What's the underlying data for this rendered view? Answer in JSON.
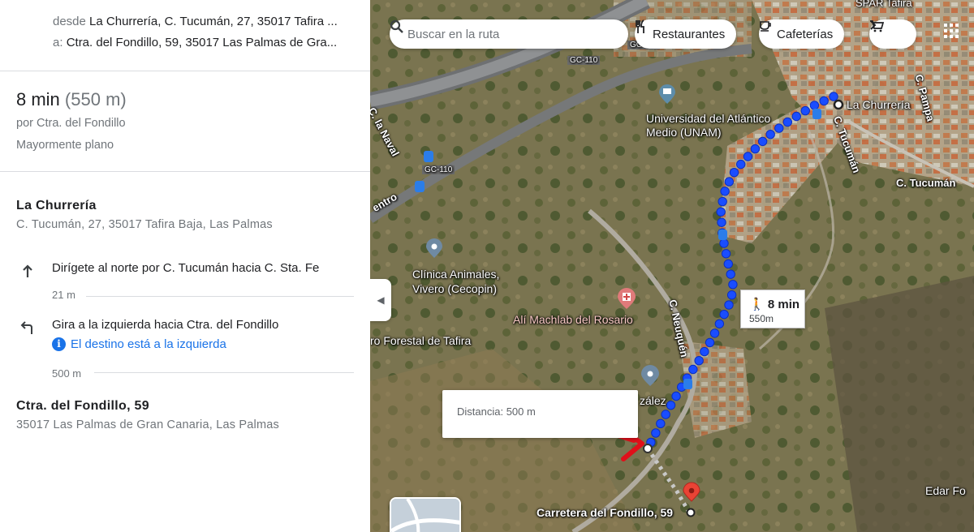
{
  "panel": {
    "from_prefix": "desde",
    "from_value": "La Churrería, C. Tucumán, 27, 35017 Tafira ...",
    "to_prefix": "a:",
    "to_value": "Ctra. del Fondillo, 59, 35017 Las Palmas de Gra...",
    "summary": {
      "time": "8 min",
      "distance": "(550 m)",
      "via": "por Ctra. del Fondillo",
      "terrain": "Mayormente plano"
    },
    "origin": {
      "name": "La Churrería",
      "address": "C. Tucumán, 27, 35017 Tafira Baja, Las Palmas"
    },
    "steps": [
      {
        "icon": "arrow-up-icon",
        "text": "Dirígete al norte por C. Tucumán hacia C. Sta. Fe",
        "distance": "21 m"
      },
      {
        "icon": "turn-left-icon",
        "text": "Gira a la izquierda hacia Ctra. del Fondillo",
        "note": "El destino está a la izquierda",
        "distance": "500 m"
      }
    ],
    "destination": {
      "name": "Ctra. del Fondillo, 59",
      "address": "35017 Las Palmas de Gran Canaria, Las Palmas"
    }
  },
  "map": {
    "search_placeholder": "Buscar en la ruta",
    "filters": [
      "Restaurantes",
      "Cafeterías"
    ],
    "labels": {
      "spar": "SPAR Tafira",
      "gc110_a": "GC-110",
      "gc110_b": "GC-110",
      "gc110_c": "GC-110",
      "c_pampa": "C. Pampa",
      "c_la_naval": "C. la Naval",
      "la_churreria": "La Churrería",
      "universidad": "Universidad del Atlántico\nMedio (UNAM)",
      "c_tucuman_v": "C. Tucumán",
      "c_tucuman_h": "C. Tucumán",
      "entro": "entro",
      "clinica": "Clínica Animales,\nVivero (Cecopin)",
      "c_neuquen": "C. Neuquén",
      "ali": "Alí Machlab del Rosario",
      "forestal": "ro Forestal de Tafira",
      "zalez": "zález",
      "edar": "Edar Fo",
      "destination": "Carretera del Fondillo, 59"
    },
    "route_bubble": {
      "time": "8 min",
      "distance": "550m"
    },
    "distance_box": "Distancia: 500 m",
    "colors": {
      "route": "#1a4dff",
      "arrow": "#e0101a",
      "pin": "#ea4335"
    }
  }
}
